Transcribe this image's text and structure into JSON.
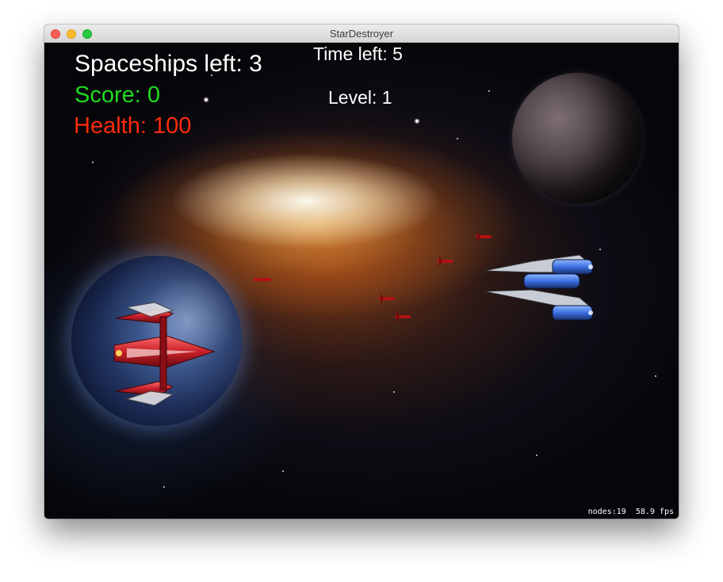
{
  "window": {
    "title": "StarDestroyer"
  },
  "hud": {
    "spaceships_left": "Spaceships left: 3",
    "score": "Score: 0",
    "health": "Health: 100",
    "time_left": "Time left: 5",
    "level": "Level: 1"
  },
  "debug": {
    "nodes": "nodes:19",
    "fps": "58.9 fps"
  },
  "colors": {
    "score": "#1fdc1f",
    "health": "#ff2b0a",
    "hud_text": "#ffffff",
    "player_ship": "#c8202a",
    "enemy_ship": "#3b6fe0",
    "missile": "#b31212"
  },
  "sprites": {
    "player": "red-spaceship",
    "enemy": "blue-spaceship",
    "projectile": "red-missile",
    "background": "nebula-space-background"
  }
}
